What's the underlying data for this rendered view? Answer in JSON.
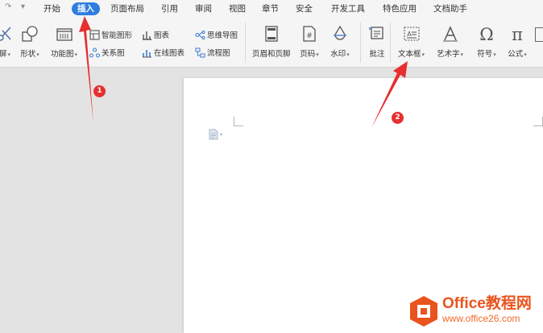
{
  "menu_tabs": [
    {
      "label": "开始"
    },
    {
      "label": "插入",
      "active": true
    },
    {
      "label": "页面布局"
    },
    {
      "label": "引用"
    },
    {
      "label": "审阅"
    },
    {
      "label": "视图"
    },
    {
      "label": "章节"
    },
    {
      "label": "安全"
    },
    {
      "label": "开发工具"
    },
    {
      "label": "特色应用"
    },
    {
      "label": "文档助手"
    }
  ],
  "ribbon": {
    "screenshot_partial": "屏",
    "shapes": "形状",
    "function_chart": "功能图",
    "smart_art": "智能图形",
    "chart": "图表",
    "mind_map": "思维导图",
    "relation_chart": "关系图",
    "online_chart": "在线图表",
    "flow_chart": "流程图",
    "header_footer": "页眉和页脚",
    "page_number": "页码",
    "watermark": "水印",
    "comment": "批注",
    "text_box": "文本框",
    "word_art": "艺术字",
    "symbol": "符号",
    "formula": "公式",
    "formula_suffix": "公式·"
  },
  "annotations": {
    "badge1": "1",
    "badge2": "2"
  },
  "watermark": {
    "title": "Office教程网",
    "url": "www.office26.com"
  },
  "colors": {
    "active_tab": "#2f7de1",
    "annotation_red": "#e62f2f",
    "watermark_orange": "#e9541e"
  }
}
